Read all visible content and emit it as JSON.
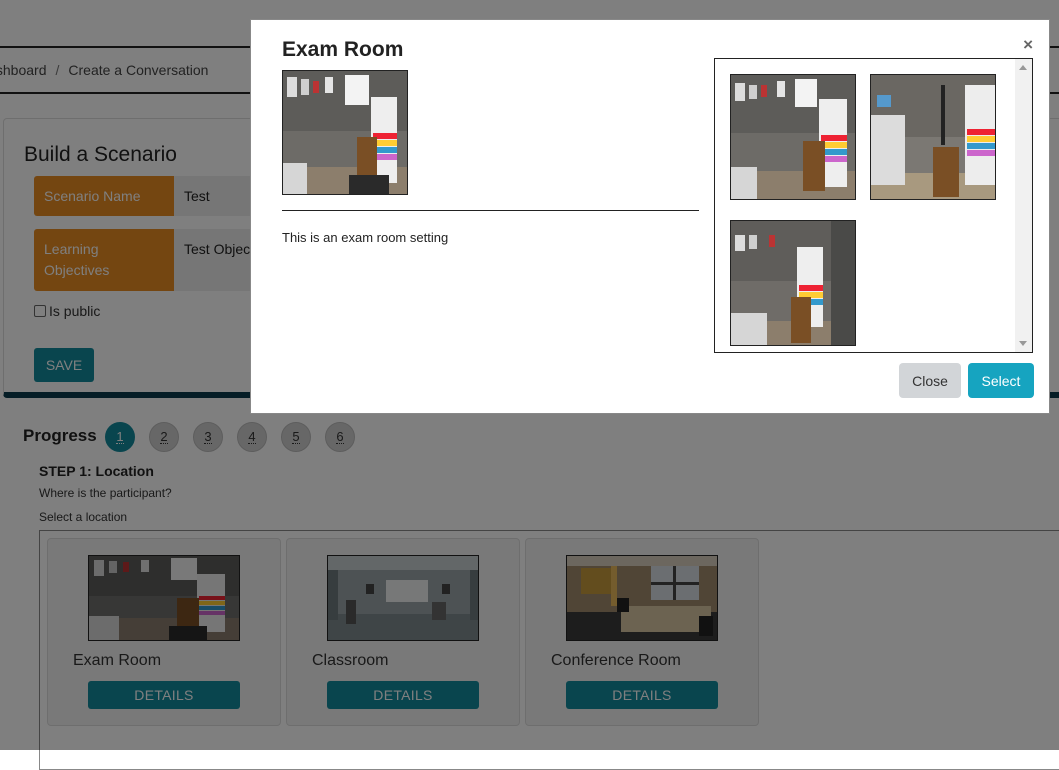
{
  "breadcrumb": {
    "items": [
      "Dashboard",
      "Create a Conversation"
    ]
  },
  "builder": {
    "title": "Build a Scenario",
    "scenario_name_label": "Scenario Name",
    "scenario_name_value": "Test",
    "objectives_label": "Learning Objectives",
    "objectives_value": "Test Objectives",
    "is_public_label": "Is public",
    "save_label": "SAVE"
  },
  "progress": {
    "label": "Progress",
    "steps": [
      "1",
      "2",
      "3",
      "4",
      "5",
      "6"
    ],
    "active_step": "1",
    "step_title": "STEP 1: Location",
    "question": "Where is the participant?",
    "select_prompt": "Select a location"
  },
  "locations": [
    {
      "name": "Exam Room",
      "details_label": "DETAILS",
      "image": "exam-room"
    },
    {
      "name": "Classroom",
      "details_label": "DETAILS",
      "image": "classroom"
    },
    {
      "name": "Conference Room",
      "details_label": "DETAILS",
      "image": "conference-room"
    }
  ],
  "modal": {
    "title": "Exam Room",
    "close_icon": "×",
    "description": "This is an exam room setting",
    "gallery": [
      "exam-room-view-1",
      "exam-room-view-2",
      "exam-room-view-3"
    ],
    "close_label": "Close",
    "select_label": "Select"
  },
  "colors": {
    "accent_teal": "#138a9c",
    "select_button": "#16a4c0",
    "label_orange": "#e88c23"
  }
}
